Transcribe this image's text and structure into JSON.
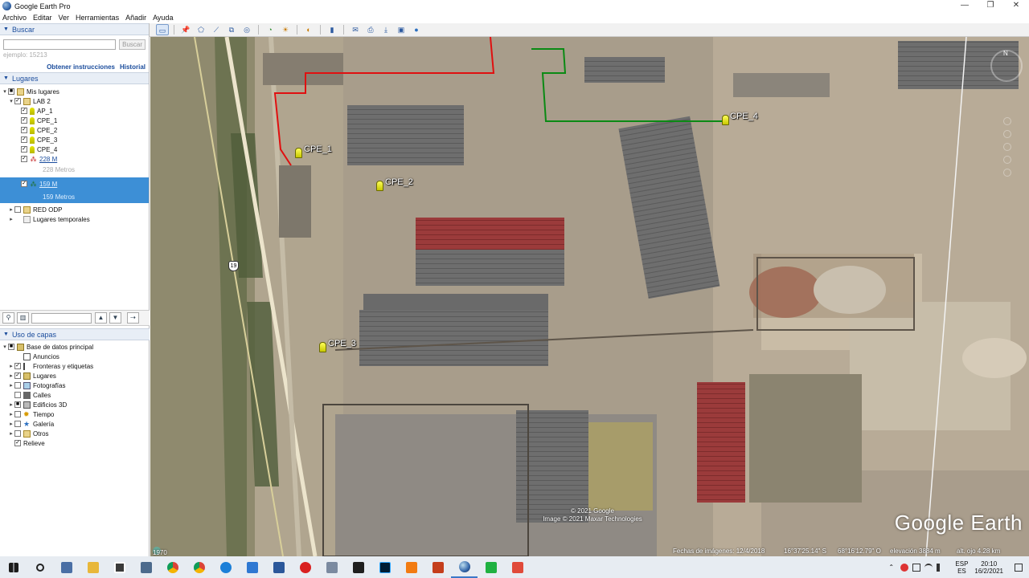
{
  "window": {
    "title": "Google Earth Pro",
    "controls": [
      "—",
      "❐",
      "✕"
    ]
  },
  "menu": [
    "Archivo",
    "Editar",
    "Ver",
    "Herramientas",
    "Añadir",
    "Ayuda"
  ],
  "search": {
    "header": "Buscar",
    "placeholder": "",
    "button": "Buscar",
    "hint": "ejemplo: 15213",
    "directions_link": "Obtener instrucciones",
    "history_link": "Historial"
  },
  "places": {
    "header": "Lugares",
    "my_places": "Mis lugares",
    "folder": "LAB 2",
    "items": [
      "AP_1",
      "CPE_1",
      "CPE_2",
      "CPE_3",
      "CPE_4"
    ],
    "path1": {
      "label": "228 M",
      "sub": "228 Metros"
    },
    "path2": {
      "label": "159 M",
      "sub": "159 Metros"
    },
    "red_odp": "RED ODP",
    "temp": "Lugares temporales"
  },
  "layers": {
    "header": "Uso de capas",
    "root": "Base de datos principal",
    "items": [
      "Anuncios",
      "Fronteras y etiquetas",
      "Lugares",
      "Fotografías",
      "Calles",
      "Edificios 3D",
      "Tiempo",
      "Galería",
      "Otros"
    ],
    "relief": "Relieve"
  },
  "map": {
    "pins": [
      "CPE_1",
      "CPE_2",
      "CPE_3",
      "CPE_4"
    ],
    "route_number": "19",
    "copyright_line1": "© 2021 Google",
    "copyright_line2": "Image © 2021 Maxar Technologies",
    "logo": "Google Earth",
    "year_button": "1970",
    "status": {
      "imagery_date": "Fechas de imágenes: 12/4/2018",
      "lat": "16°37'25.14\" S",
      "lon": "68°16'12.79\" O",
      "elevation": "elevación  3884 m",
      "eye_alt": "alt. ojo  4.28 km"
    },
    "compass_n": "N"
  },
  "taskbar": {
    "lang_line1": "ESP",
    "lang_line2": "ES",
    "time": "20:10",
    "date": "16/2/2021"
  },
  "colors": {
    "accent": "#3d8fd6",
    "link": "#1a4c9c",
    "red_path": "#e01010",
    "green_path": "#0a8a14"
  }
}
